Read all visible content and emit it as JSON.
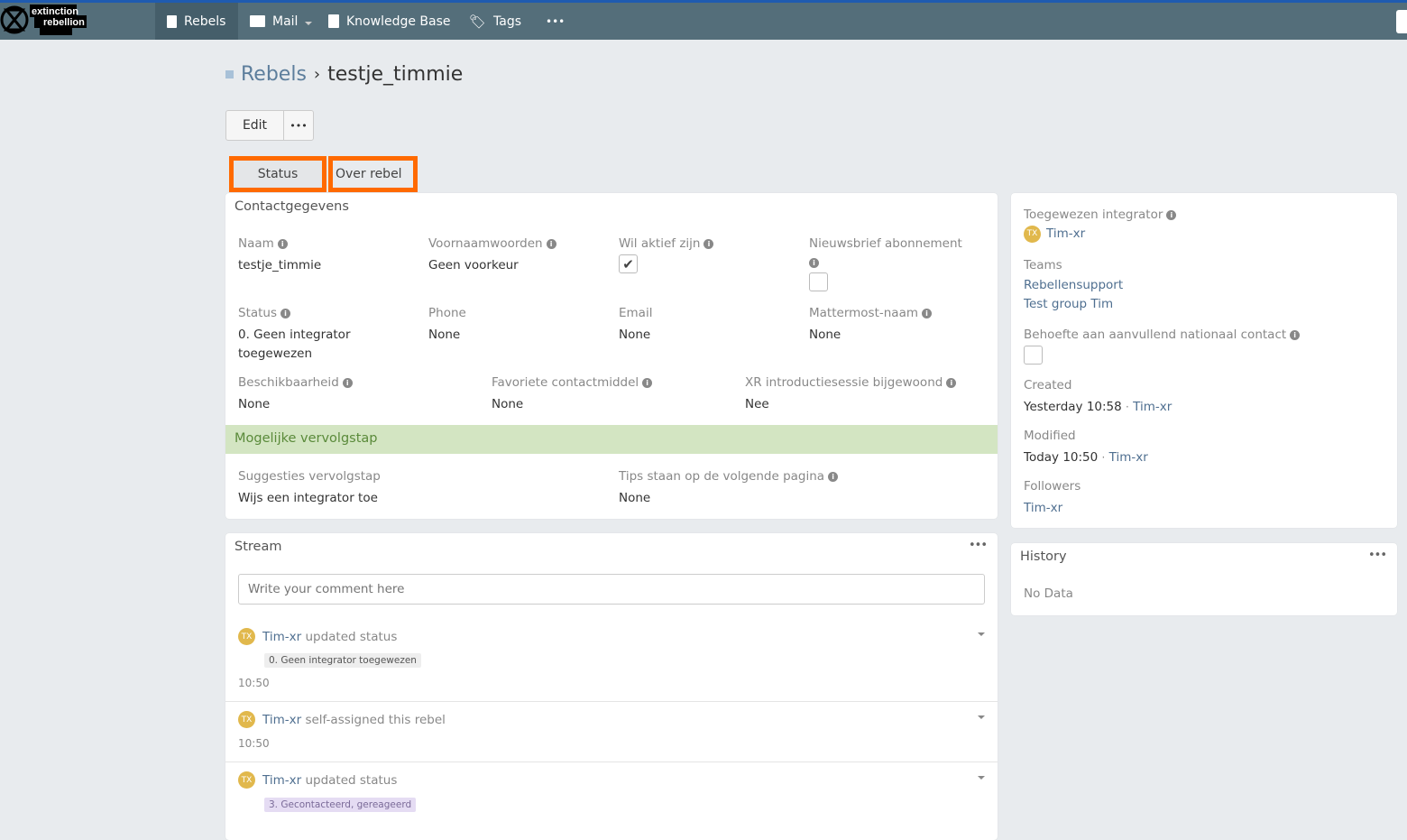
{
  "nav": {
    "logo_text": "extinction rebellion",
    "items": [
      {
        "label": "Rebels",
        "icon": "contact-card-icon"
      },
      {
        "label": "Mail",
        "icon": "mail-icon"
      },
      {
        "label": "Knowledge Base",
        "icon": "book-icon"
      },
      {
        "label": "Tags",
        "icon": "tag-icon"
      }
    ],
    "more": "•••"
  },
  "breadcrumb": {
    "parent": "Rebels",
    "sep": "›",
    "current": "testje_timmie"
  },
  "actions": {
    "edit": "Edit",
    "more": "•••"
  },
  "tabs": [
    "Status",
    "Over rebel"
  ],
  "contact": {
    "title": "Contactgegevens",
    "row1": [
      {
        "label": "Naam",
        "value": "testje_timmie"
      },
      {
        "label": "Voornaamwoorden",
        "value": "Geen voorkeur"
      },
      {
        "label": "Wil aktief zijn",
        "checked": true
      },
      {
        "label": "Nieuwsbrief abonnement",
        "checked": false
      }
    ],
    "row2": [
      {
        "label": "Status",
        "value": "0. Geen integrator toegewezen"
      },
      {
        "label": "Phone",
        "value": "None"
      },
      {
        "label": "Email",
        "value": "None"
      },
      {
        "label": "Mattermost-naam",
        "value": "None"
      }
    ],
    "row3": [
      {
        "label": "Beschikbaarheid",
        "value": "None"
      },
      {
        "label": "Favoriete contactmiddel",
        "value": "None"
      },
      {
        "label": "XR introductiesessie bijgewoond",
        "value": "Nee"
      }
    ]
  },
  "next": {
    "title": "Mogelijke vervolgstap",
    "fields": [
      {
        "label": "Suggesties vervolgstap",
        "value": "Wijs een integrator toe"
      },
      {
        "label": "Tips staan op de volgende pagina",
        "value": "None"
      }
    ]
  },
  "side": {
    "integrator_label": "Toegewezen integrator",
    "integrator": "Tim-xr",
    "avatar": "TX",
    "teams_label": "Teams",
    "teams": [
      "Rebellensupport",
      "Test group Tim"
    ],
    "behoefte_label": "Behoefte aan aanvullend nationaal contact",
    "created_label": "Created",
    "created": "Yesterday 10:58",
    "created_by": "Tim-xr",
    "modified_label": "Modified",
    "modified": "Today 10:50",
    "modified_by": "Tim-xr",
    "followers_label": "Followers",
    "followers": "Tim-xr",
    "dot": "·"
  },
  "stream": {
    "title": "Stream",
    "placeholder": "Write your comment here",
    "items": [
      {
        "user": "Tim-xr",
        "action": "updated status",
        "badge": "0. Geen integrator toegewezen",
        "time": "10:50"
      },
      {
        "user": "Tim-xr",
        "action": "self-assigned this rebel",
        "time": "10:50"
      },
      {
        "user": "Tim-xr",
        "action": "updated status",
        "badge": "3. Gecontacteerd, gereageerd"
      }
    ]
  },
  "history": {
    "title": "History",
    "empty": "No Data"
  },
  "colors": {
    "nav": "#546e7a",
    "highlight": "#ff6a00",
    "green_band": "#d3e5c2",
    "avatar": "#e1b84c"
  }
}
